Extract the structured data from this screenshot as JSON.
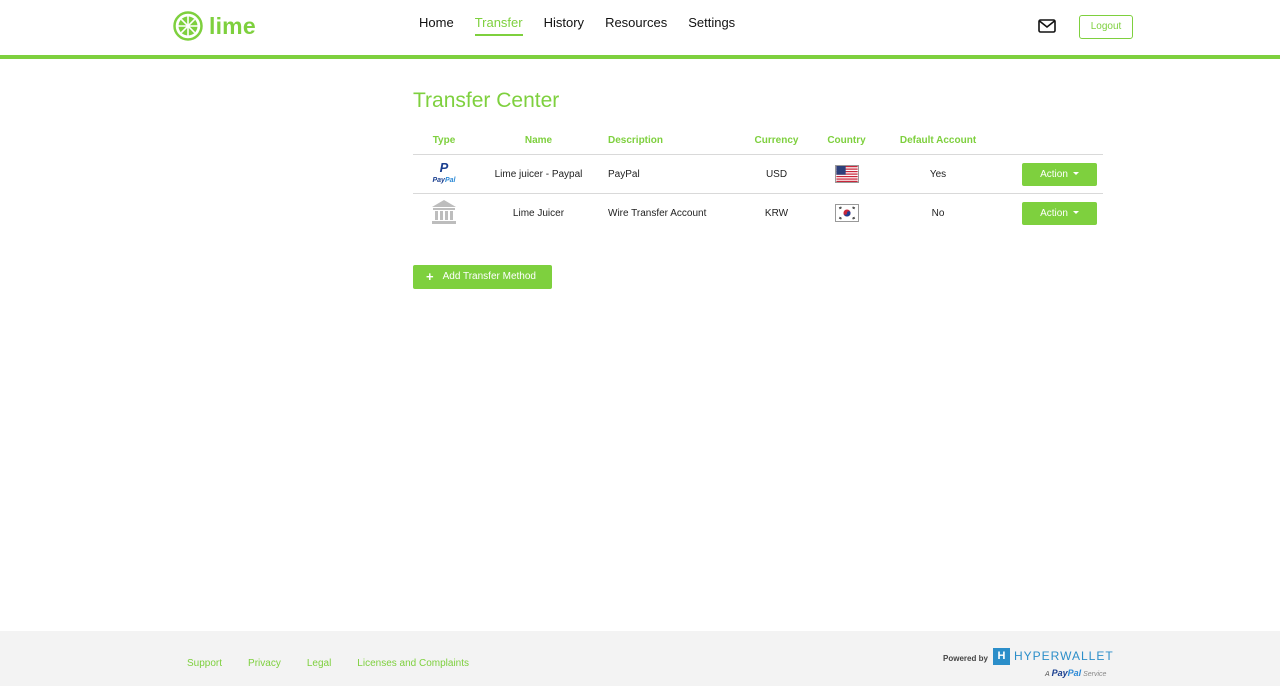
{
  "header": {
    "brand": "lime",
    "nav": [
      {
        "label": "Home",
        "active": false
      },
      {
        "label": "Transfer",
        "active": true
      },
      {
        "label": "History",
        "active": false
      },
      {
        "label": "Resources",
        "active": false
      },
      {
        "label": "Settings",
        "active": false
      }
    ],
    "mail_icon": "mail-icon",
    "logout_label": "Logout"
  },
  "main": {
    "title": "Transfer Center",
    "columns": [
      "Type",
      "Name",
      "Description",
      "Currency",
      "Country",
      "Default Account"
    ],
    "rows": [
      {
        "type_icon": "paypal-icon",
        "name": "Lime juicer - Paypal",
        "description": "PayPal",
        "currency": "USD",
        "country_icon": "us-flag-icon",
        "default": "Yes",
        "action": "Action"
      },
      {
        "type_icon": "bank-icon",
        "name": "Lime Juicer",
        "description": "Wire Transfer Account",
        "currency": "KRW",
        "country_icon": "kr-flag-icon",
        "default": "No",
        "action": "Action"
      }
    ],
    "add_button": "Add Transfer Method"
  },
  "footer": {
    "links": [
      "Support",
      "Privacy",
      "Legal",
      "Licenses and Complaints"
    ],
    "powered_by": "Powered by",
    "hyperwallet": "HYPERWALLET",
    "paypal_service": {
      "a": "A",
      "pay": "Pay",
      "pal": "Pal",
      "service": "Service"
    }
  },
  "colors": {
    "accent": "#7ed03e",
    "hyperwallet": "#2b8ec9",
    "footer_bg": "#f3f3f3"
  }
}
